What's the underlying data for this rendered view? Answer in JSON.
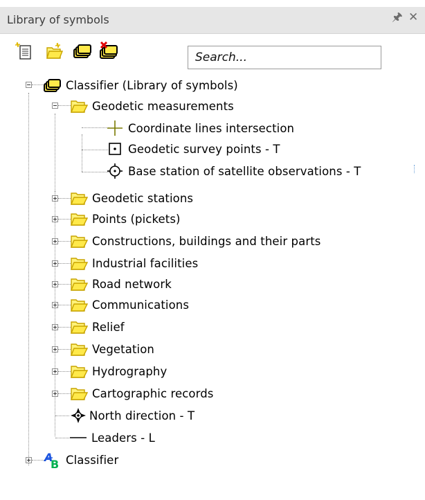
{
  "panel": {
    "title": "Library of symbols",
    "pin_icon": "pin-icon",
    "close_icon": "close-icon"
  },
  "toolbar": {
    "buttons": [
      {
        "name": "new-symbol-button",
        "icon": "new-document-icon"
      },
      {
        "name": "new-folder-button",
        "icon": "new-folder-icon"
      },
      {
        "name": "library-button",
        "icon": "library-icon"
      },
      {
        "name": "remove-library-button",
        "icon": "delete-library-icon"
      }
    ],
    "search_placeholder": "Search..."
  },
  "tree": {
    "root": {
      "label": "Classifier (Library of symbols)",
      "expanded": true
    },
    "geodetic_measurements": {
      "label": "Geodetic measurements",
      "expanded": true,
      "children": [
        {
          "label": "Coordinate lines intersection",
          "icon": "cross-symbol-icon"
        },
        {
          "label": "Geodetic survey points - T",
          "icon": "square-dot-symbol-icon"
        },
        {
          "label": "Base station of satellite observations - T",
          "icon": "circle-target-symbol-icon"
        }
      ]
    },
    "folders": [
      "Geodetic stations",
      "Points (pickets)",
      "Constructions, buildings and their parts",
      "Industrial facilities",
      "Road network",
      "Communications",
      "Relief",
      "Vegetation",
      "Hydrography",
      "Cartographic records"
    ],
    "root_items": [
      {
        "label": "North direction - T",
        "icon": "compass-symbol-icon"
      },
      {
        "label": "Leaders - L",
        "icon": "line-symbol-icon"
      }
    ],
    "second_root": {
      "label": "Classifier",
      "icon": "classifier-ab-icon",
      "expanded": false
    }
  },
  "colors": {
    "title_bar": "#e6e6e6",
    "folder_fill": "#fff27a",
    "folder_stroke": "#c8a400",
    "symbol_cross": "#7a7a00"
  }
}
